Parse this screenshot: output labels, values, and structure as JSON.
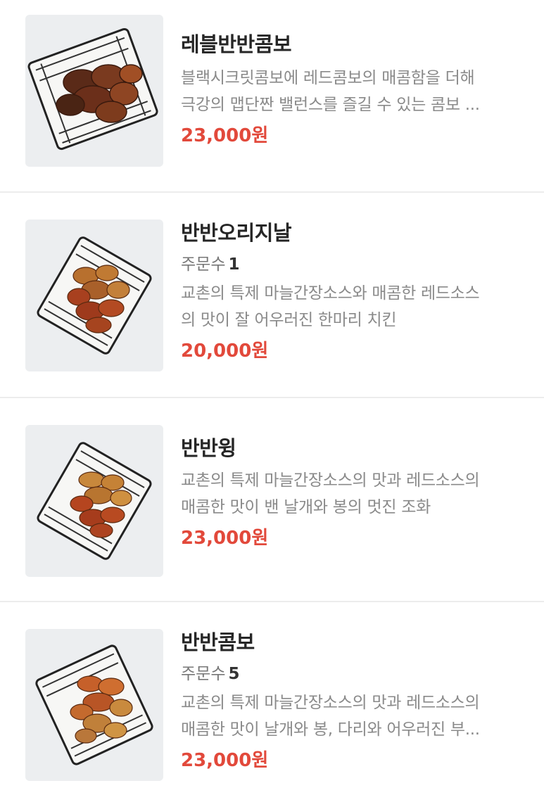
{
  "menu": [
    {
      "name": "레블반반콤보",
      "orders_label": null,
      "orders_count": null,
      "desc_lines": [
        "블랙시크릿콤보에 레드콤보의 매콤함을 더해",
        "극강의 맵단짠 밸런스를 즐길 수 있는 콤보 ..."
      ],
      "price": "23,000원"
    },
    {
      "name": "반반오리지날",
      "orders_label": "주문수",
      "orders_count": "1",
      "desc_lines": [
        "교촌의 특제 마늘간장소스와 매콤한 레드소스",
        "의 맛이 잘 어우러진 한마리 치킨"
      ],
      "price": "20,000원"
    },
    {
      "name": "반반윙",
      "orders_label": null,
      "orders_count": null,
      "desc_lines": [
        "교촌의 특제 마늘간장소스의 맛과 레드소스의",
        "매콤한 맛이 밴 날개와 봉의 멋진 조화"
      ],
      "price": "23,000원"
    },
    {
      "name": "반반콤보",
      "orders_label": "주문수",
      "orders_count": "5",
      "desc_lines": [
        "교촌의 특제 마늘간장소스의 맛과 레드소스의",
        "매콤한 맛이 날개와 봉, 다리와 어우러진 부..."
      ],
      "price": "23,000원"
    }
  ],
  "colors": {
    "price": "#e2493b",
    "thumb_bg": "#eceef0",
    "divider": "#ececec"
  },
  "icons": {
    "thumb": "fried-chicken-basket-image"
  }
}
